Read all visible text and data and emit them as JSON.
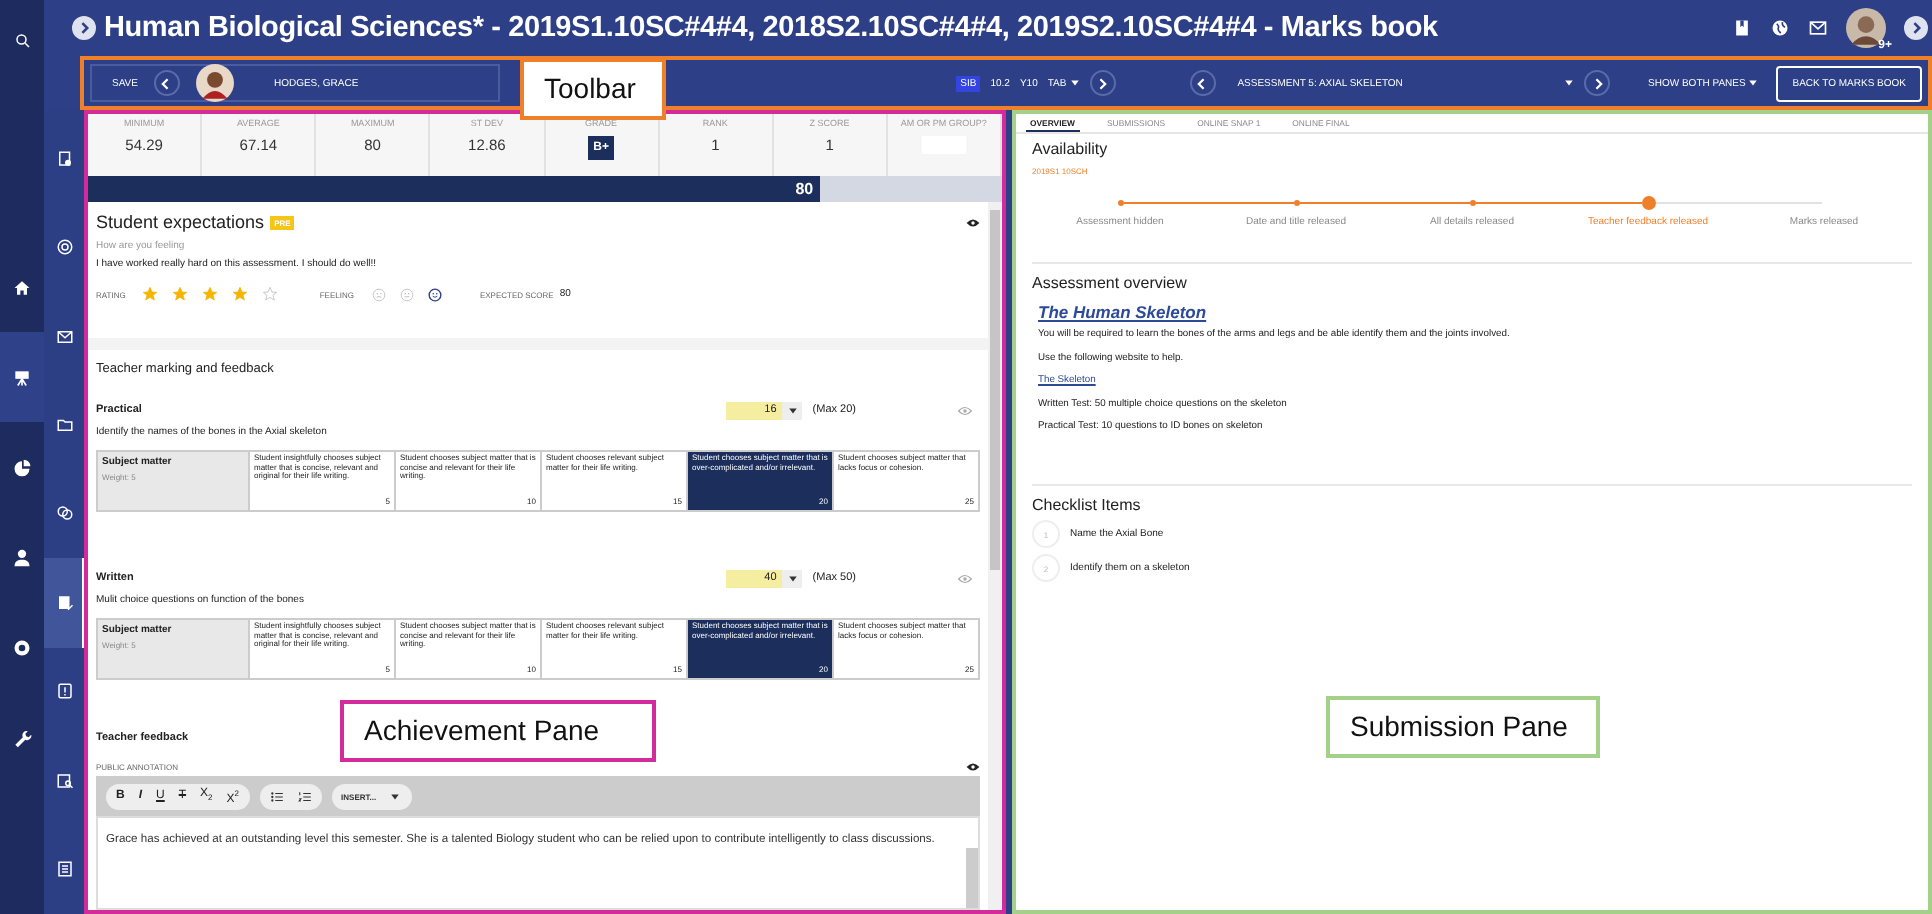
{
  "window": {
    "title": "Human Biological Sciences* - 2019S1.10SC#4#4, 2018S2.10SC#4#4, 2019S2.10SC#4#4 - Marks book",
    "badge": "9+"
  },
  "nav_rail": [
    {
      "selected": false
    },
    {
      "selected": true
    },
    {
      "selected": false
    },
    {
      "selected": false
    },
    {
      "selected": false
    },
    {
      "selected": false
    }
  ],
  "tool_rail": [
    {
      "selected": false
    },
    {
      "selected": false
    },
    {
      "selected": false
    },
    {
      "selected": false
    },
    {
      "selected": false
    },
    {
      "selected": true
    },
    {
      "selected": false
    },
    {
      "selected": false
    },
    {
      "selected": false
    }
  ],
  "toolbar": {
    "save": "SAVE",
    "student": "HODGES, GRACE",
    "class_badge": "SIB",
    "class_code": "10.2",
    "year": "Y10",
    "tab_menu": "TAB",
    "assessment": "ASSESSMENT 5: AXIAL SKELETON",
    "panes_menu": "SHOW BOTH PANES",
    "back_button": "BACK TO MARKS BOOK"
  },
  "annotations": [
    {
      "text": "Toolbar",
      "color": "#f07f2a"
    },
    {
      "text": "Achievement Pane",
      "color": "#d42b9c"
    },
    {
      "text": "Submission Pane",
      "color": "#a4d18a"
    }
  ],
  "stats": [
    {
      "label": "MINIMUM",
      "value": "54.29",
      "kind": "text"
    },
    {
      "label": "AVERAGE",
      "value": "67.14",
      "kind": "text"
    },
    {
      "label": "MAXIMUM",
      "value": "80",
      "kind": "text"
    },
    {
      "label": "ST DEV",
      "value": "12.86",
      "kind": "text"
    },
    {
      "label": "GRADE",
      "value": "B+",
      "kind": "grade"
    },
    {
      "label": "RANK",
      "value": "1",
      "kind": "text"
    },
    {
      "label": "Z SCORE",
      "value": "1",
      "kind": "text"
    },
    {
      "label": "AM OR PM GROUP?",
      "kind": "input"
    }
  ],
  "score_bar": {
    "level": 0.8,
    "value": "80"
  },
  "expectations": {
    "title": "Student expectations",
    "badge": "PRE",
    "prompt": "How are you feeling",
    "answer": "I have worked really hard on this assessment. I should do well!!",
    "rating_label": "RATING",
    "stars": 4,
    "feeling_label": "FEELING",
    "feelings": [
      {
        "selected": false
      },
      {
        "selected": false
      },
      {
        "selected": true
      }
    ],
    "expected_label": "EXPECTED SCORE",
    "expected_score": "80"
  },
  "marking": {
    "heading": "Teacher marking and feedback",
    "criteria": [
      {
        "name": "Practical",
        "score": "16",
        "max": "(Max 20)",
        "description": "Identify the names of the bones in the Axial skeleton",
        "rubric": {
          "name": "Subject matter",
          "weight": "Weight: 5",
          "levels": [
            {
              "text": "Student insightfully chooses subject matter that is concise, relevant and original for their life writing.",
              "score": "5",
              "selected": false
            },
            {
              "text": "Student chooses subject matter that is concise and relevant for their life writing.",
              "score": "10",
              "selected": false
            },
            {
              "text": "Student chooses relevant subject matter for their life writing.",
              "score": "15",
              "selected": false
            },
            {
              "text": "Student chooses subject matter that is over-complicated and/or irrelevant.",
              "score": "20",
              "selected": true
            },
            {
              "text": "Student chooses subject matter that lacks focus or cohesion.",
              "score": "25",
              "selected": false
            }
          ]
        }
      },
      {
        "name": "Written",
        "score": "40",
        "max": "(Max 50)",
        "description": "Mulit choice questions on function of the bones",
        "rubric": {
          "name": "Subject matter",
          "weight": "Weight: 5",
          "levels": [
            {
              "text": "Student insightfully chooses subject matter that is concise, relevant and original for their life writing.",
              "score": "5",
              "selected": false
            },
            {
              "text": "Student chooses subject matter that is concise and relevant for their life writing.",
              "score": "10",
              "selected": false
            },
            {
              "text": "Student chooses relevant subject matter for their life writing.",
              "score": "15",
              "selected": false
            },
            {
              "text": "Student chooses subject matter that is over-complicated and/or irrelevant.",
              "score": "20",
              "selected": true
            },
            {
              "text": "Student chooses subject matter that lacks focus or cohesion.",
              "score": "25",
              "selected": false
            }
          ]
        }
      }
    ]
  },
  "feedback": {
    "heading": "Teacher feedback",
    "label": "PUBLIC ANNOTATION",
    "format_buttons": [
      {
        "text": "B",
        "kind": "bold"
      },
      {
        "text": "I",
        "kind": "italic"
      },
      {
        "text": "U",
        "kind": "underline"
      },
      {
        "text": "T",
        "kind": "strike"
      },
      {
        "text": "X$_{2}$",
        "kind": "script"
      },
      {
        "text": "X$^{2}$",
        "kind": "script"
      }
    ],
    "insert": "INSERT...",
    "text": "Grace has achieved at an outstanding level this semester. She is a talented Biology student who can be relied upon to contribute intelligently to class discussions."
  },
  "submission_tabs": [
    {
      "label": "OVERVIEW",
      "selected": true
    },
    {
      "label": "SUBMISSIONS",
      "selected": false
    },
    {
      "label": "ONLINE SNAP 1",
      "selected": false
    },
    {
      "label": "ONLINE FINAL",
      "selected": false
    }
  ],
  "availability": {
    "heading": "Availability",
    "term": "2019S1 10SCH",
    "steps": [
      {
        "label": "Assessment hidden",
        "reached": true,
        "current": false
      },
      {
        "label": "Date and title released",
        "reached": true,
        "current": false
      },
      {
        "label": "All details released",
        "reached": true,
        "current": false
      },
      {
        "label": "Teacher feedback released",
        "reached": true,
        "current": true
      },
      {
        "label": "Marks released",
        "reached": false,
        "current": false
      }
    ]
  },
  "overview": {
    "heading": "Assessment overview",
    "title": "The Human Skeleton",
    "content": [
      {
        "kind": "text",
        "text": "You will be required to learn the bones of the arms and legs and be able identify them and the joints involved."
      },
      {
        "kind": "text",
        "text": "Use the following website to help."
      },
      {
        "kind": "link",
        "text": "The Skeleton"
      },
      {
        "kind": "text",
        "text": "Written Test: 50 multiple choice questions on the skeleton"
      },
      {
        "kind": "text",
        "text": "Practical Test: 10 questions to ID bones on skeleton"
      }
    ]
  },
  "checklist": {
    "heading": "Checklist Items",
    "items": [
      {
        "number": "1",
        "text": "Name the Axial Bone"
      },
      {
        "number": "2",
        "text": "Identify them on a skeleton"
      }
    ]
  }
}
